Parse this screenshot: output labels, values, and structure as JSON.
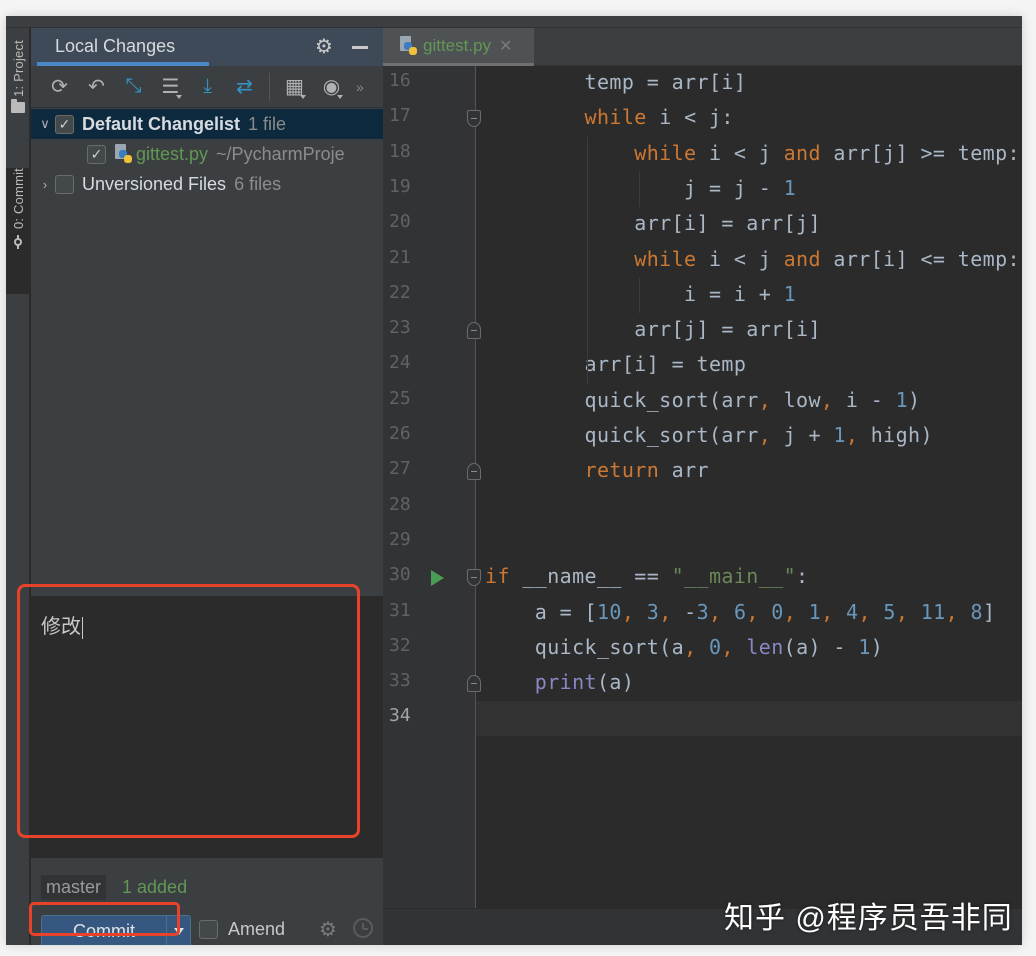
{
  "toolstrip": {
    "project_label": "1: Project",
    "commit_label": "0: Commit"
  },
  "panel": {
    "title": "Local Changes",
    "toolbar": [
      {
        "name": "refresh",
        "glyph": "⟳"
      },
      {
        "name": "rollback",
        "glyph": "↶"
      },
      {
        "name": "show-diff",
        "glyph": "⇆"
      },
      {
        "name": "changelist",
        "glyph": "☰"
      },
      {
        "name": "update",
        "glyph": "⤓"
      },
      {
        "name": "merge",
        "glyph": "⇄"
      },
      {
        "name": "group-by",
        "glyph": "▦"
      },
      {
        "name": "view-options",
        "glyph": "◉"
      }
    ],
    "more": "»",
    "tree": [
      {
        "name": "Default Changelist",
        "meta": "1 file",
        "checked": true,
        "expanded": true
      },
      {
        "name": "gittest.py",
        "meta": "~/PycharmProje",
        "checked": true
      },
      {
        "name": "Unversioned Files",
        "meta": "6 files",
        "checked": false,
        "expanded": false
      }
    ],
    "commit_message": "修改",
    "branch": "master",
    "change_summary": "1 added",
    "commit_label": "Commit",
    "amend_label": "Amend",
    "amend_checked": false
  },
  "editor": {
    "tab_name": "gittest.py",
    "current_line": 34,
    "lines": [
      {
        "n": "16",
        "t": "        temp = arr[i]"
      },
      {
        "n": "17",
        "t": "        while i < j:"
      },
      {
        "n": "18",
        "t": "            while i < j and arr[j] >= temp:"
      },
      {
        "n": "19",
        "t": "                j = j - 1"
      },
      {
        "n": "20",
        "t": "            arr[i] = arr[j]"
      },
      {
        "n": "21",
        "t": "            while i < j and arr[i] <= temp:"
      },
      {
        "n": "22",
        "t": "                i = i + 1"
      },
      {
        "n": "23",
        "t": "            arr[j] = arr[i]"
      },
      {
        "n": "24",
        "t": "        arr[i] = temp"
      },
      {
        "n": "25",
        "t": "        quick_sort(arr, low, i - 1)"
      },
      {
        "n": "26",
        "t": "        quick_sort(arr, j + 1, high)"
      },
      {
        "n": "27",
        "t": "        return arr"
      },
      {
        "n": "28",
        "t": ""
      },
      {
        "n": "29",
        "t": ""
      },
      {
        "n": "30",
        "t": "if __name__ == \"__main__\":"
      },
      {
        "n": "31",
        "t": "    a = [10, 3, -3, 6, 0, 1, 4, 5, 11, 8]"
      },
      {
        "n": "32",
        "t": "    quick_sort(a, 0, len(a) - 1)"
      },
      {
        "n": "33",
        "t": "    print(a)"
      },
      {
        "n": "34",
        "t": ""
      }
    ]
  },
  "watermark": "知乎 @程序员吾非同",
  "colors": {
    "keyword": "#cc7832",
    "number": "#6897bb",
    "string": "#6a8759",
    "builtin": "#8888c6",
    "default_text": "#a9b7c6",
    "added_green": "#629755",
    "commit_button": "#365880",
    "highlight_red": "#e8432a",
    "selection": "#0d293e"
  }
}
